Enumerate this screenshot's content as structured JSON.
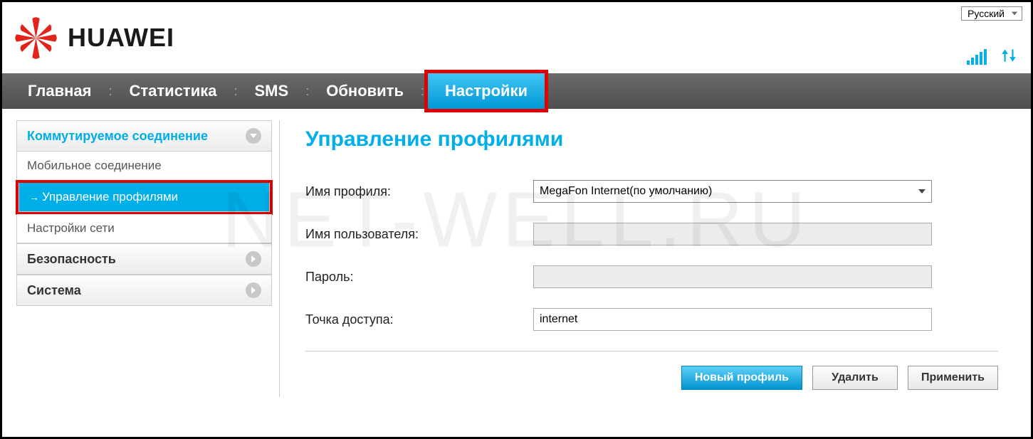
{
  "watermark": "NET-WELL.RU",
  "brand": "HUAWEI",
  "language": "Русский",
  "nav": {
    "home": "Главная",
    "stats": "Статистика",
    "sms": "SMS",
    "update": "Обновить",
    "settings": "Настройки"
  },
  "sidebar": {
    "dialup": "Коммутируемое соединение",
    "mobile": "Мобильное соединение",
    "profiles": "Управление профилями",
    "network": "Настройки сети",
    "security": "Безопасность",
    "system": "Система"
  },
  "page_title": "Управление профилями",
  "form": {
    "profile_name_label": "Имя профиля:",
    "profile_name_value": "MegaFon Internet(по умолчанию)",
    "username_label": "Имя пользователя:",
    "username_value": "",
    "password_label": "Пароль:",
    "password_value": "",
    "apn_label": "Точка доступа:",
    "apn_value": "internet"
  },
  "buttons": {
    "new": "Новый профиль",
    "delete": "Удалить",
    "apply": "Применить"
  }
}
